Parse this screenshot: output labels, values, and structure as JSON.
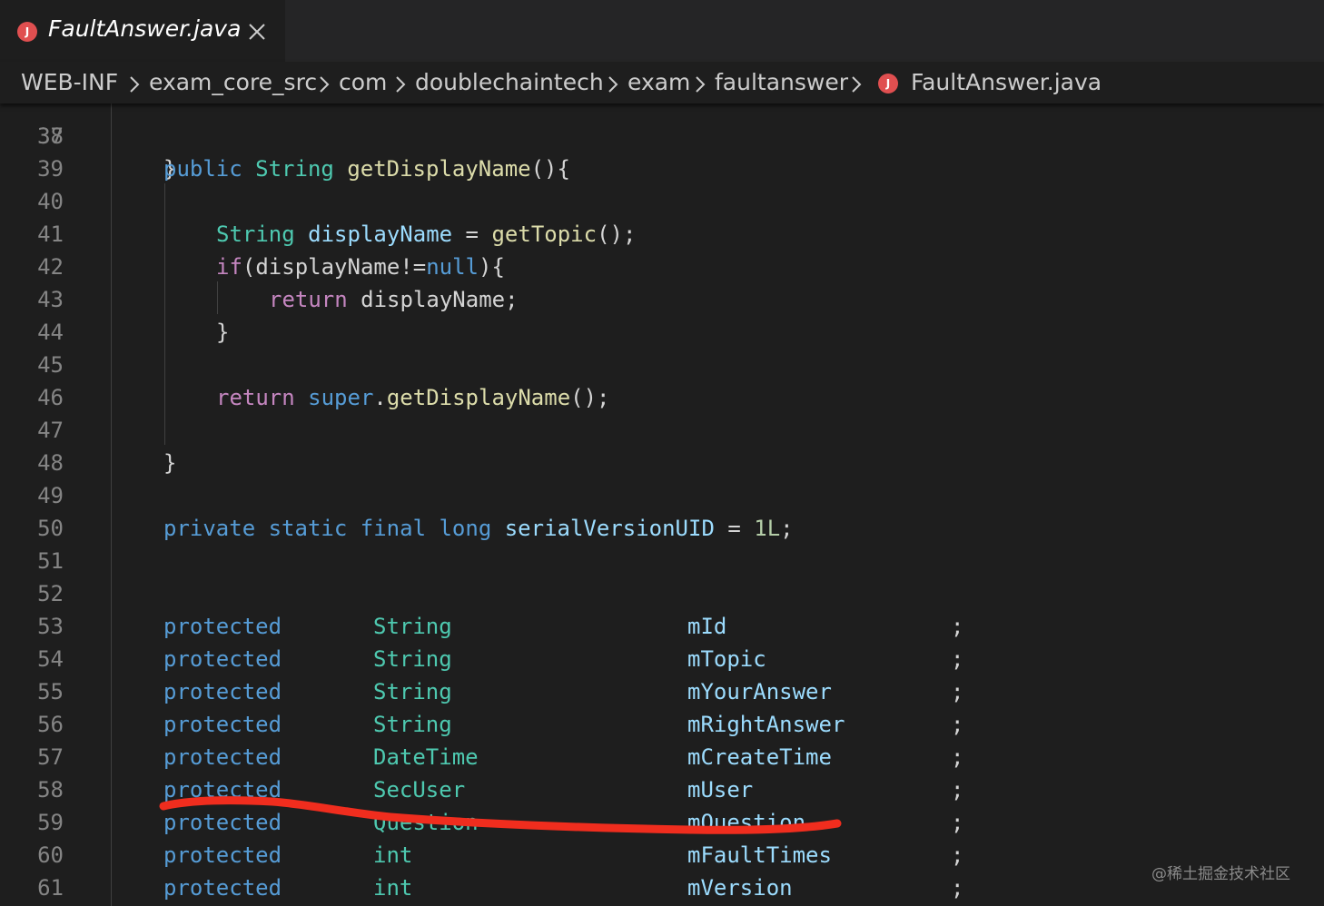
{
  "tab": {
    "title": "FaultAnswer.java",
    "icon_letter": "J",
    "icon_color": "#e04f50"
  },
  "breadcrumb": {
    "items": [
      "WEB-INF",
      "exam_core_src",
      "com",
      "doublechaintech",
      "exam",
      "faultanswer",
      "FaultAnswer.java"
    ],
    "file_icon_letter": "J"
  },
  "editor": {
    "partial_top_line": {
      "number": "37",
      "text": "}"
    },
    "lines": [
      {
        "n": "38"
      },
      {
        "n": "39",
        "indent": 1,
        "tokens": [
          [
            "kw",
            "public"
          ],
          [
            "p",
            " "
          ],
          [
            "ty",
            "String"
          ],
          [
            "p",
            " "
          ],
          [
            "fn",
            "getDisplayName"
          ],
          [
            "p",
            "(){"
          ]
        ]
      },
      {
        "n": "40"
      },
      {
        "n": "41",
        "indent": 2,
        "tokens": [
          [
            "ty",
            "String"
          ],
          [
            "p",
            " "
          ],
          [
            "va",
            "displayName"
          ],
          [
            "p",
            " = "
          ],
          [
            "fn",
            "getTopic"
          ],
          [
            "p",
            "();"
          ]
        ]
      },
      {
        "n": "42",
        "indent": 2,
        "tokens": [
          [
            "ctl",
            "if"
          ],
          [
            "p",
            "(displayName!="
          ],
          [
            "kw",
            "null"
          ],
          [
            "p",
            "){"
          ]
        ]
      },
      {
        "n": "43",
        "indent": 3,
        "tokens": [
          [
            "ctl",
            "return"
          ],
          [
            "p",
            " displayName;"
          ]
        ]
      },
      {
        "n": "44",
        "indent": 2,
        "tokens": [
          [
            "p",
            "}"
          ]
        ]
      },
      {
        "n": "45"
      },
      {
        "n": "46",
        "indent": 2,
        "tokens": [
          [
            "ctl",
            "return"
          ],
          [
            "p",
            " "
          ],
          [
            "kw",
            "super"
          ],
          [
            "p",
            "."
          ],
          [
            "fn",
            "getDisplayName"
          ],
          [
            "p",
            "();"
          ]
        ]
      },
      {
        "n": "47"
      },
      {
        "n": "48",
        "indent": 1,
        "tokens": [
          [
            "p",
            "}"
          ]
        ]
      },
      {
        "n": "49"
      },
      {
        "n": "50",
        "indent": 1,
        "tokens": [
          [
            "kw",
            "private"
          ],
          [
            "p",
            " "
          ],
          [
            "kw",
            "static"
          ],
          [
            "p",
            " "
          ],
          [
            "kw",
            "final"
          ],
          [
            "p",
            " "
          ],
          [
            "kw",
            "long"
          ],
          [
            "p",
            " "
          ],
          [
            "va",
            "serialVersionUID"
          ],
          [
            "p",
            " = "
          ],
          [
            "nu",
            "1L"
          ],
          [
            "p",
            ";"
          ]
        ]
      },
      {
        "n": "51"
      },
      {
        "n": "52"
      },
      {
        "n": "53",
        "field": [
          "protected",
          "String",
          "mId",
          ";"
        ]
      },
      {
        "n": "54",
        "field": [
          "protected",
          "String",
          "mTopic",
          ";"
        ]
      },
      {
        "n": "55",
        "field": [
          "protected",
          "String",
          "mYourAnswer",
          ";"
        ]
      },
      {
        "n": "56",
        "field": [
          "protected",
          "String",
          "mRightAnswer",
          ";"
        ]
      },
      {
        "n": "57",
        "field": [
          "protected",
          "DateTime",
          "mCreateTime",
          ";"
        ]
      },
      {
        "n": "58",
        "field": [
          "protected",
          "SecUser",
          "mUser",
          ";"
        ]
      },
      {
        "n": "59",
        "field": [
          "protected",
          "Question",
          "mQuestion",
          ";"
        ]
      },
      {
        "n": "60",
        "field": [
          "protected",
          "int",
          "mFaultTimes",
          ";"
        ]
      },
      {
        "n": "61",
        "field": [
          "protected",
          "int",
          "mVersion",
          ";"
        ]
      }
    ]
  },
  "annotation": {
    "color": "#f02d1e",
    "description_visible": false
  },
  "watermark": "@稀土掘金技术社区",
  "colors": {
    "editor_bg": "#1e1e1e",
    "tabbar_bg": "#252526",
    "keyword": "#569cd6",
    "type": "#4ec9b0",
    "function": "#dcdcaa",
    "variable": "#9cdcfe",
    "control": "#c586c0",
    "number": "#b5cea8",
    "line_number": "#858585"
  }
}
